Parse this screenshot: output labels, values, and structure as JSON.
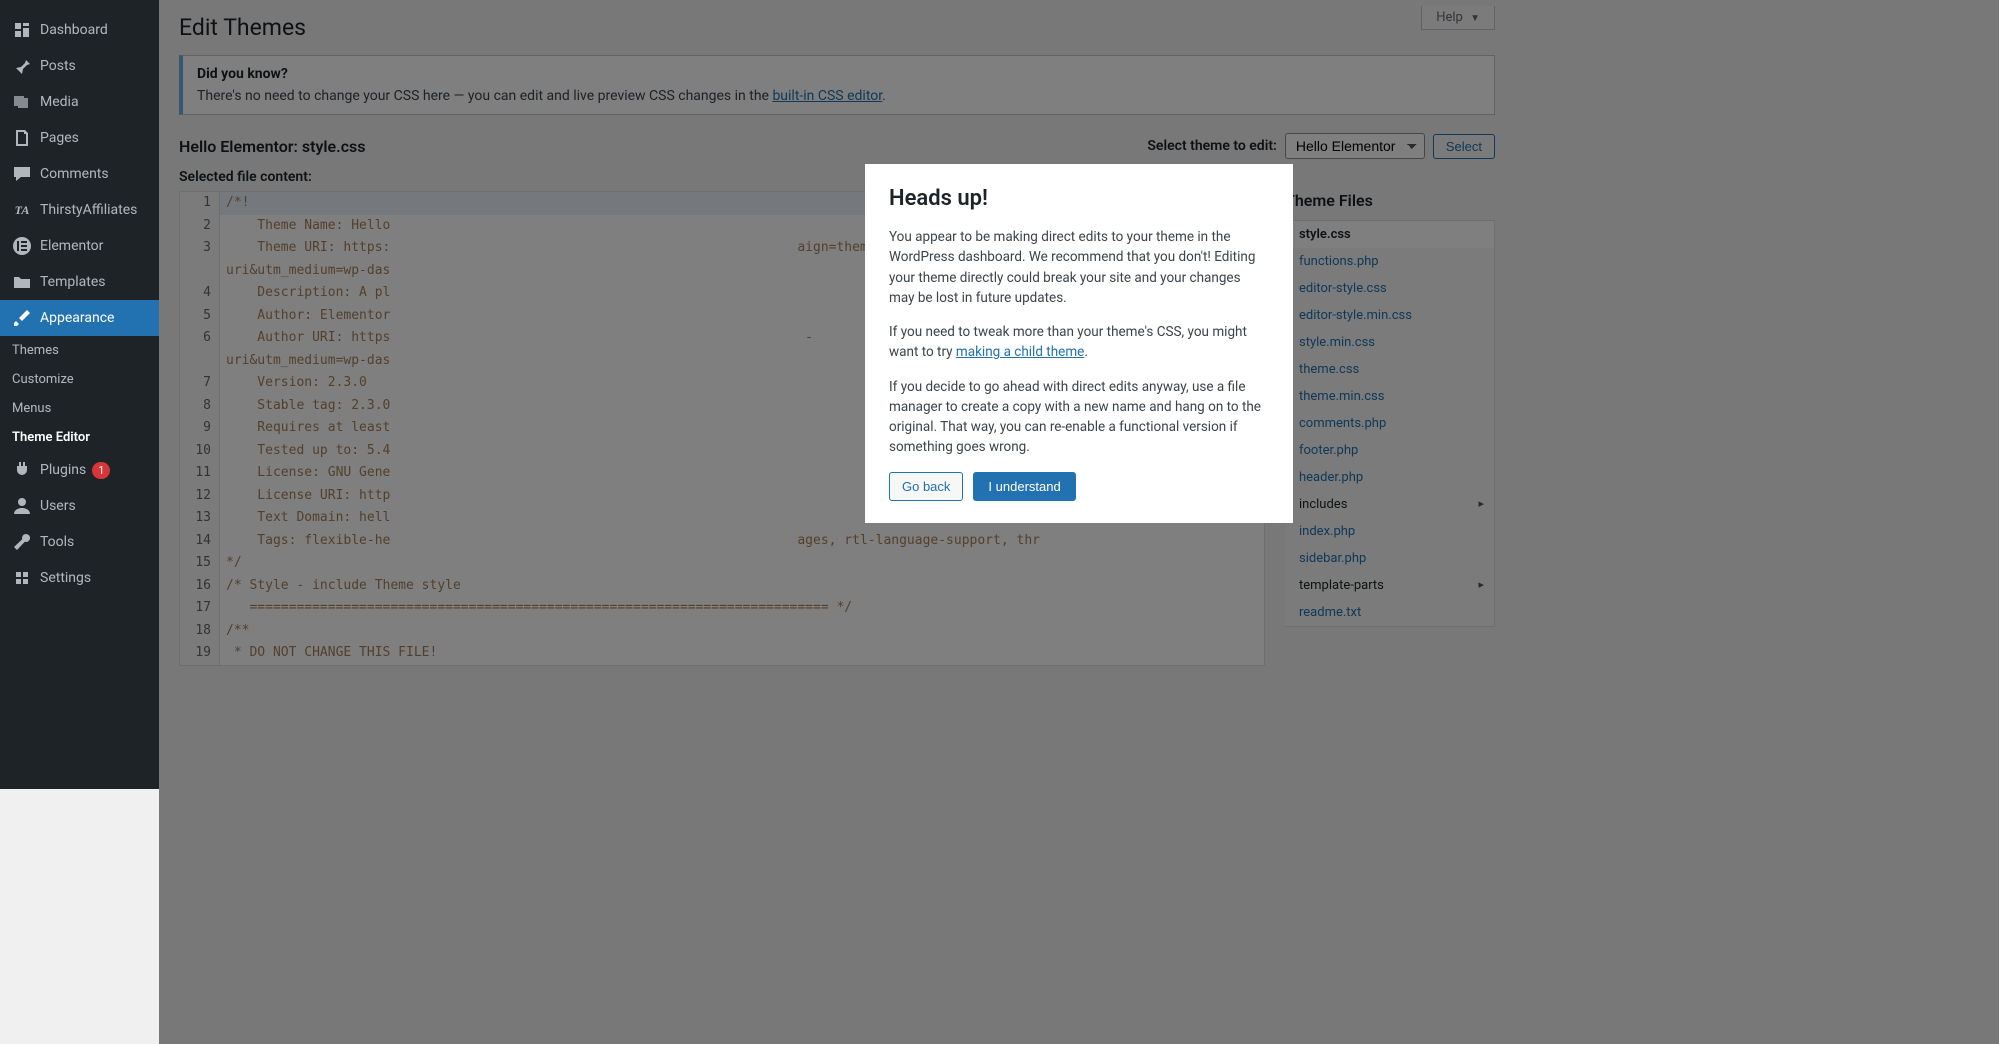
{
  "sidebar": {
    "items": [
      {
        "label": "Dashboard",
        "icon": "dashboard-icon"
      },
      {
        "label": "Posts",
        "icon": "pin-icon"
      },
      {
        "label": "Media",
        "icon": "media-icon"
      },
      {
        "label": "Pages",
        "icon": "page-icon"
      },
      {
        "label": "Comments",
        "icon": "comment-icon"
      },
      {
        "label": "ThirstyAffiliates",
        "icon": "ta-icon"
      },
      {
        "label": "Elementor",
        "icon": "elementor-icon"
      },
      {
        "label": "Templates",
        "icon": "folder-icon"
      },
      {
        "label": "Appearance",
        "icon": "brush-icon"
      },
      {
        "label": "Plugins",
        "icon": "plug-icon",
        "badge": "1"
      },
      {
        "label": "Users",
        "icon": "user-icon"
      },
      {
        "label": "Tools",
        "icon": "wrench-icon"
      },
      {
        "label": "Settings",
        "icon": "settings-icon"
      }
    ],
    "submenu": [
      {
        "label": "Themes"
      },
      {
        "label": "Customize"
      },
      {
        "label": "Menus"
      },
      {
        "label": "Theme Editor",
        "active": true
      }
    ]
  },
  "header": {
    "help_label": "Help",
    "page_title": "Edit Themes"
  },
  "notice": {
    "heading": "Did you know?",
    "body_pre": "There's no need to change your CSS here — you can edit and live preview CSS changes in the ",
    "link_text": "built-in CSS editor",
    "body_post": "."
  },
  "theme_bar": {
    "editing_label": "Hello Elementor: style.css",
    "select_label": "Select theme to edit:",
    "select_value": "Hello Elementor",
    "select_button": "Select"
  },
  "selected_file_label": "Selected file content:",
  "code_lines": [
    "/*!",
    "    Theme Name: Hello",
    "    Theme URI: https:                                                    aign=theme-uri&utm_medium=wp-das",
    "    Description: A pl",
    "    Author: Elementor",
    "    Author URI: https                                                     -uri&utm_medium=wp-das",
    "    Version: 2.3.0",
    "    Stable tag: 2.3.0",
    "    Requires at least",
    "    Tested up to: 5.4",
    "    License: GNU Gene",
    "    License URI: http",
    "    Text Domain: hell",
    "    Tags: flexible-he                                                    ages, rtl-language-support, thr",
    "*/",
    "/* Style - include Theme style",
    "   ========================================================================== */",
    "/**",
    " * DO NOT CHANGE THIS FILE!"
  ],
  "theme_files": {
    "heading": "Theme Files",
    "files": [
      {
        "name": "style.css",
        "active": true
      },
      {
        "name": "functions.php"
      },
      {
        "name": "editor-style.css"
      },
      {
        "name": "editor-style.min.css"
      },
      {
        "name": "style.min.css"
      },
      {
        "name": "theme.css"
      },
      {
        "name": "theme.min.css"
      },
      {
        "name": "comments.php"
      },
      {
        "name": "footer.php"
      },
      {
        "name": "header.php"
      },
      {
        "name": "includes",
        "folder": true
      },
      {
        "name": "index.php"
      },
      {
        "name": "sidebar.php"
      },
      {
        "name": "template-parts",
        "folder": true
      },
      {
        "name": "readme.txt"
      }
    ]
  },
  "modal": {
    "title": "Heads up!",
    "p1": "You appear to be making direct edits to your theme in the WordPress dashboard. We recommend that you don't! Editing your theme directly could break your site and your changes may be lost in future updates.",
    "p2_pre": "If you need to tweak more than your theme's CSS, you might want to try ",
    "p2_link": "making a child theme",
    "p2_post": ".",
    "p3": "If you decide to go ahead with direct edits anyway, use a file manager to create a copy with a new name and hang on to the original. That way, you can re-enable a functional version if something goes wrong.",
    "go_back": "Go back",
    "understand": "I understand"
  }
}
